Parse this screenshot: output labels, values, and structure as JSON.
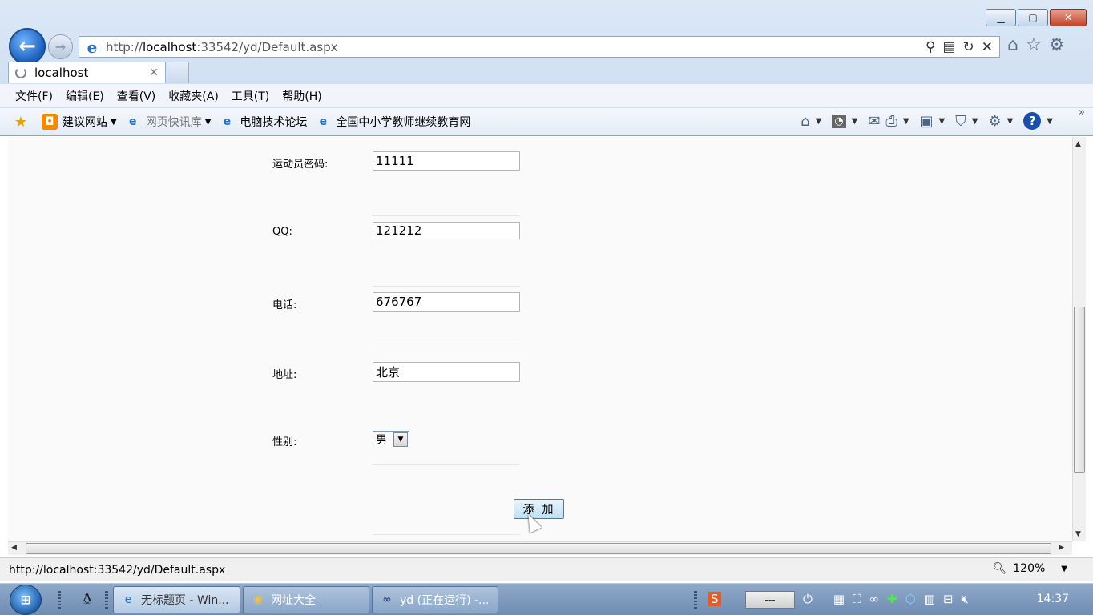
{
  "browser": {
    "url": "http://localhost:33542/yd/Default.aspx",
    "url_host_part": "localhost",
    "tab_title": "localhost",
    "menu": [
      "文件(F)",
      "编辑(E)",
      "查看(V)",
      "收藏夹(A)",
      "工具(T)",
      "帮助(H)"
    ],
    "favorites": [
      {
        "label": "建议网站",
        "has_dropdown": true,
        "greyed": false
      },
      {
        "label": "网页快讯库",
        "has_dropdown": true,
        "greyed": true
      },
      {
        "label": "电脑技术论坛",
        "has_dropdown": false,
        "greyed": false
      },
      {
        "label": "全国中小学教师继续教育网",
        "has_dropdown": false,
        "greyed": false
      }
    ]
  },
  "form": {
    "password_label": "运动员密码:",
    "password_value": "11111",
    "qq_label": "QQ:",
    "qq_value": "121212",
    "phone_label": "电话:",
    "phone_value": "676767",
    "address_label": "地址:",
    "address_value": "北京",
    "gender_label": "性别:",
    "gender_value": "男",
    "add_button": "添加"
  },
  "statusbar": {
    "url": "http://localhost:33542/yd/Default.aspx",
    "zoom": "120%"
  },
  "taskbar": {
    "tasks": [
      {
        "label": "无标题页 - Win...",
        "active": true
      },
      {
        "label": "网址大全",
        "active": false
      },
      {
        "label": "yd (正在运行) -...",
        "active": false
      }
    ],
    "ime_text": "---",
    "clock": "14:37"
  }
}
